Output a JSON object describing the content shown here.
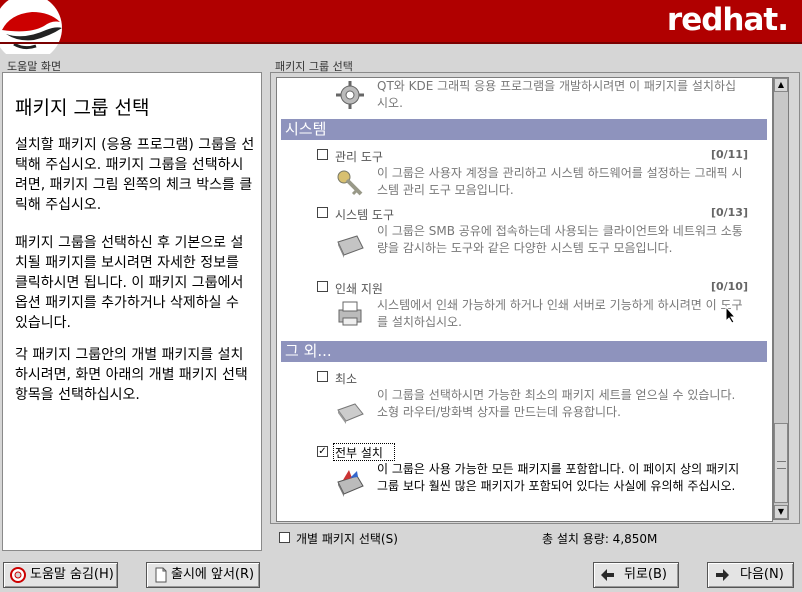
{
  "banner": {
    "brand": "redhat."
  },
  "help": {
    "frame_label": "도움말 화면",
    "title": "패키지 그룹 선택",
    "paragraphs": [
      "설치할 패키지 (응용 프로그램) 그룹을 선택해 주십시오. 패키지 그룹을 선택하시려면, 패키지 그림 왼쪽의 체크 박스를 클릭해 주십시오.",
      "패키지 그룹을 선택하신 후 기본으로 설치될 패키지를 보시려면 자세한 정보를 클릭하시면 됩니다. 이 패키지 그룹에서 옵션 패키지를 추가하거나 삭제하실 수 있습니다.",
      "각 패키지 그룹안의 개별 패키지를 설치하시려면, 화면 아래의 개별 패키지 선택 항목을 선택하십시오."
    ]
  },
  "packages": {
    "frame_label": "패키지 그룹 선택",
    "top_partial_desc": "QT와 KDE 그래픽 응용 프로그램을 개발하시려면 이 패키지를 설치하십시오.",
    "sections": [
      {
        "title": "시스템",
        "items": [
          {
            "label": "관리 도구",
            "count": "[0/11]",
            "checked": false,
            "icon": "keys-icon",
            "desc": "이 그룹은 사용자 계정을 관리하고 시스템 하드웨어를 설정하는 그래픽 시스템 관리 도구 모음입니다."
          },
          {
            "label": "시스템 도구",
            "count": "[0/13]",
            "checked": false,
            "icon": "toolbox-icon",
            "desc": "이 그룹은 SMB 공유에 접속하는데 사용되는 클라이언트와 네트워크 소통량을 감시하는 도구와 같은 다양한 시스템 도구 모음입니다."
          },
          {
            "label": "인쇄 지원",
            "count": "[0/10]",
            "checked": false,
            "icon": "printer-icon",
            "desc": "시스템에서 인쇄 가능하게 하거나 인쇄 서버로 기능하게 하시려면 이 도구를 설치하십시오."
          }
        ]
      },
      {
        "title": "그 외...",
        "items": [
          {
            "label": "최소",
            "count": "",
            "checked": false,
            "icon": "box-icon",
            "desc": "이 그룹을 선택하시면 가능한 최소의 패키지 세트를 얻으실 수 있습니다. 소형 라우터/방화벽 상자를 만드는데 유용합니다."
          },
          {
            "label": "전부 설치",
            "count": "",
            "checked": true,
            "icon": "full-box-icon",
            "desc": "이 그룹은 사용 가능한 모든 패키지를 포함합니다. 이 페이지 상의 패키지 그룹 보다 훨씬 많은 패키지가 포함되어 있다는 사실에 유의해 주십시오."
          }
        ]
      }
    ],
    "individual_label": "개별 패키지 선택(S)",
    "total_size": "총 설치 용량: 4,850M"
  },
  "buttons": {
    "hide_help": "도움말 숨김(H)",
    "release_notes": "출시에 앞서(R)",
    "back": "뒤로(B)",
    "next": "다음(N)"
  }
}
